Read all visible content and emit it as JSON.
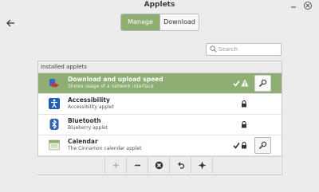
{
  "window": {
    "title": "Applets",
    "minimize_icon": "minimize-icon",
    "close_icon": "close-icon"
  },
  "nav": {
    "back_icon": "back-arrow-icon"
  },
  "tabs": [
    {
      "label": "Manage",
      "active": true
    },
    {
      "label": "Download",
      "active": false
    }
  ],
  "search": {
    "placeholder": "Search",
    "value": "",
    "icon": "search-icon"
  },
  "list": {
    "header": "Installed applets",
    "items": [
      {
        "name": "Download and upload speed",
        "description": "Shows usage of a network interface",
        "icon": "network-speed-icon",
        "selected": true,
        "enabled": true,
        "warning": true,
        "configurable": true
      },
      {
        "name": "Accessibility",
        "description": "Accessibility applet",
        "icon": "accessibility-icon",
        "selected": false,
        "locked": true
      },
      {
        "name": "Bluetooth",
        "description": "Blueberry applet",
        "icon": "bluetooth-icon",
        "selected": false,
        "locked": true
      },
      {
        "name": "Calendar",
        "description": "The Cinnamon calendar applet",
        "icon": "calendar-icon",
        "selected": false,
        "enabled": true,
        "locked": true,
        "configurable": true
      }
    ]
  },
  "toolbar": {
    "buttons": [
      "add-icon",
      "remove-icon",
      "clear-icon",
      "undo-icon",
      "more-icon"
    ]
  },
  "colors": {
    "accent": "#8fae73",
    "selection_text": "#ffffff",
    "background": "#ececec"
  }
}
